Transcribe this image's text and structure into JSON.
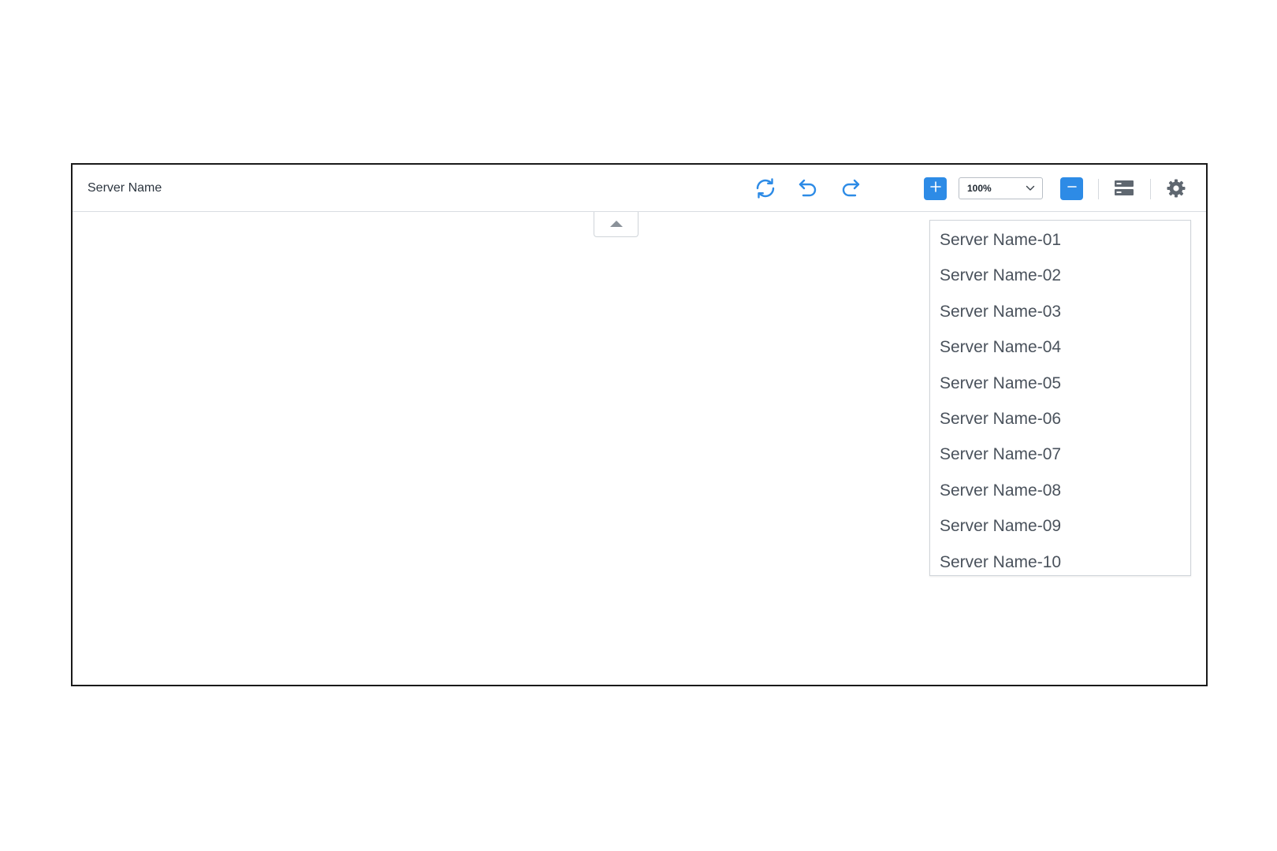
{
  "header": {
    "title": "Server Name"
  },
  "toolbar": {
    "refresh_icon": "refresh-icon",
    "undo_icon": "undo-icon",
    "redo_icon": "redo-icon",
    "zoom_in_icon": "plus-icon",
    "zoom_value": "100%",
    "zoom_out_icon": "minus-icon",
    "layout_icon": "server-list-icon",
    "settings_icon": "gear-icon",
    "accent_color": "#2d8be6",
    "icon_color": "#2d8be6",
    "muted_icon_color": "#6b737c"
  },
  "collapse_tab": {
    "icon": "caret-up-icon"
  },
  "dropdown": {
    "items": [
      {
        "label": "Server Name-01"
      },
      {
        "label": "Server Name-02"
      },
      {
        "label": "Server Name-03"
      },
      {
        "label": "Server Name-04"
      },
      {
        "label": "Server Name-05"
      },
      {
        "label": "Server Name-06"
      },
      {
        "label": "Server Name-07"
      },
      {
        "label": "Server Name-08"
      },
      {
        "label": "Server Name-09"
      },
      {
        "label": "Server Name-10"
      }
    ]
  }
}
